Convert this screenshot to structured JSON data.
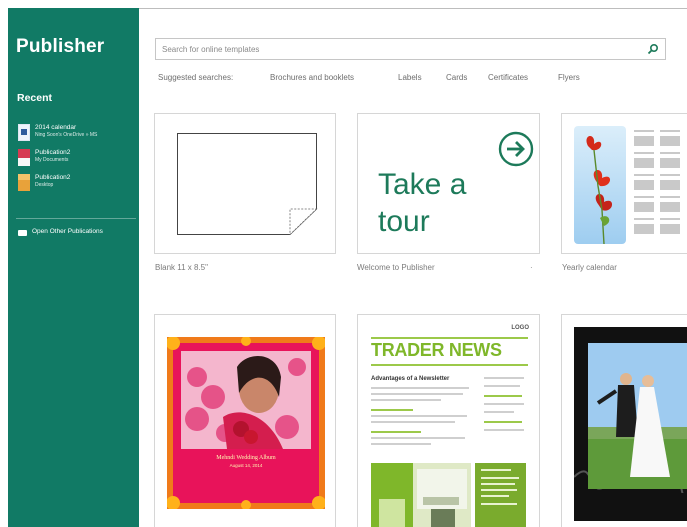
{
  "app": {
    "title": "Publisher"
  },
  "sidebar": {
    "recent_header": "Recent",
    "recent_items": [
      {
        "name": "2014 calendar",
        "path": "Ning Soon's OneDrive » MS",
        "thumb_color": "#2f5b9c"
      },
      {
        "name": "Publication2",
        "path": "My Documents",
        "thumb_color": "#d63a52"
      },
      {
        "name": "Publication2",
        "path": "Desktop",
        "thumb_color": "#e8a23a"
      }
    ],
    "open_other_label": "Open Other Publications"
  },
  "search": {
    "placeholder": "Search for online templates",
    "value": ""
  },
  "suggested": {
    "label": "Suggested searches:",
    "items": [
      "Brochures and booklets",
      "Labels",
      "Cards",
      "Certificates",
      "Flyers"
    ]
  },
  "templates": [
    {
      "caption": "Blank 11 x 8.5\""
    },
    {
      "caption": "Welcome to Publisher",
      "text_line1": "Take a",
      "text_line2": "tour",
      "pin": "·"
    },
    {
      "caption": "Yearly calendar"
    },
    {
      "caption": "",
      "card_text": "Mehndi Wedding Album",
      "card_subtext": "August 14, 2014"
    },
    {
      "caption": "",
      "logo": "LOGO",
      "title": "TRADER NEWS",
      "headline": "Advantages of a Newsletter"
    },
    {
      "caption": ""
    }
  ],
  "colors": {
    "sidebar": "#117a65",
    "accent": "#1d7a5a",
    "news_green": "#7fb72a"
  }
}
